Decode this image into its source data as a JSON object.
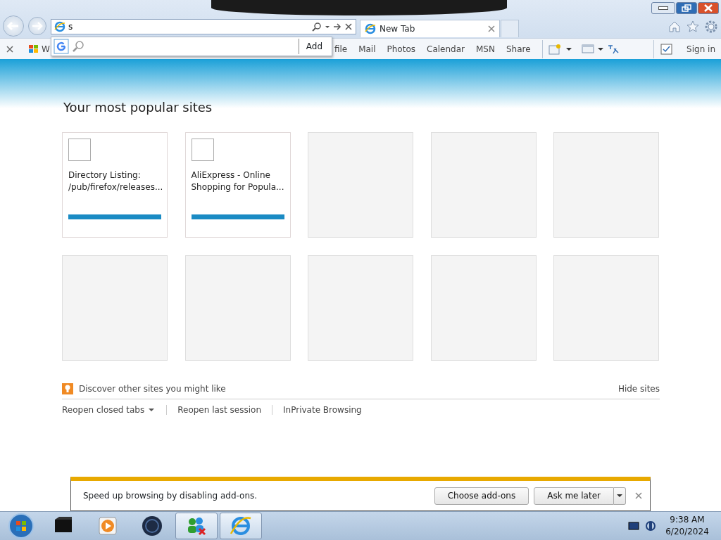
{
  "window": {
    "controls": [
      {
        "kind": "minimize"
      },
      {
        "kind": "restore"
      },
      {
        "kind": "close"
      }
    ]
  },
  "address_bar": {
    "value": "s"
  },
  "tabs": [
    {
      "label": "New Tab",
      "selected": true
    }
  ],
  "search_dropdown": {
    "button": "Add"
  },
  "favorites_bar": [
    {
      "label": "W",
      "kind": "flag"
    },
    {
      "label": "file",
      "kind": "hidden"
    },
    {
      "label": "Mail",
      "kind": "plain"
    },
    {
      "label": "Photos",
      "kind": "plain"
    },
    {
      "label": "Calendar",
      "kind": "plain"
    },
    {
      "label": "MSN",
      "kind": "plain"
    },
    {
      "label": "Share",
      "kind": "plain"
    }
  ],
  "sign_in": "Sign in",
  "heading": "Your most popular sites",
  "tiles": [
    {
      "kind": "site",
      "title": "Directory Listing: /pub/firefox/releases...",
      "level": 1
    },
    {
      "kind": "site",
      "title": "AliExpress - Online Shopping for Popula...",
      "level": 1
    },
    {
      "kind": "empty"
    },
    {
      "kind": "empty"
    },
    {
      "kind": "empty"
    },
    {
      "kind": "empty"
    },
    {
      "kind": "empty"
    },
    {
      "kind": "empty"
    },
    {
      "kind": "empty"
    },
    {
      "kind": "empty"
    }
  ],
  "discover": "Discover other sites you might like",
  "hide_sites": "Hide sites",
  "links": [
    {
      "label": "Reopen closed tabs",
      "dropdown": true
    },
    {
      "label": "Reopen last session",
      "dropdown": false
    },
    {
      "label": "InPrivate Browsing",
      "dropdown": false
    }
  ],
  "notification": {
    "message": "Speed up browsing by disabling add-ons.",
    "buttons": [
      "Choose add-ons",
      "Ask me later"
    ]
  },
  "taskbar": {
    "apps": [
      {
        "kind": "box",
        "selected": false
      },
      {
        "kind": "player",
        "selected": false
      },
      {
        "kind": "globe",
        "selected": false
      },
      {
        "kind": "people",
        "selected": true
      },
      {
        "kind": "ie",
        "selected": true
      }
    ],
    "time": "9:38 AM",
    "date": "6/20/2024"
  }
}
